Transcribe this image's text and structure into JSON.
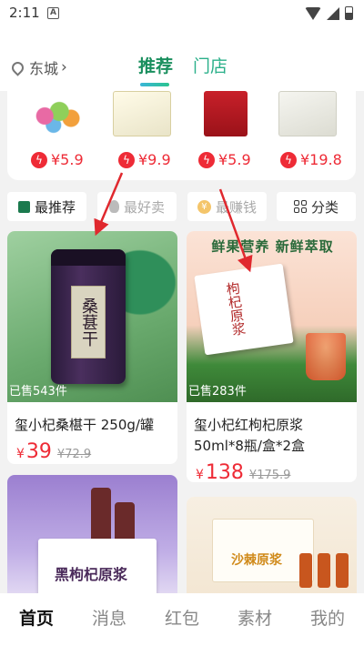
{
  "status": {
    "time": "2:11",
    "notif_badge": "A"
  },
  "header": {
    "location": "东城",
    "tabs": [
      "推荐",
      "门店"
    ],
    "active_tab": "推荐"
  },
  "flash_sale": [
    {
      "price": "¥5.9",
      "icon": "bolt-icon"
    },
    {
      "price": "¥9.9",
      "icon": "bolt-icon"
    },
    {
      "price": "¥5.9",
      "icon": "bolt-icon"
    },
    {
      "price": "¥19.8",
      "icon": "bolt-icon"
    }
  ],
  "filters": [
    {
      "label": "最推荐",
      "icon": "recommend-icon",
      "active": true
    },
    {
      "label": "最好卖",
      "icon": "hot-icon",
      "active": false
    },
    {
      "label": "最赚钱",
      "icon": "money-icon",
      "active": false
    },
    {
      "label": "分类",
      "icon": "grid-icon",
      "active": false
    }
  ],
  "products": [
    {
      "image_text": "桑葚干",
      "sold": "已售543件",
      "title": "玺小杞桑椹干 250g/罐",
      "price": "39",
      "original_price": "¥72.9",
      "currency": "¥"
    },
    {
      "image_text": "鲜果营养 新鲜萃取",
      "box_text": "枸杞原浆",
      "sold": "已售283件",
      "title": "玺小杞红枸杞原浆 50ml*8瓶/盒*2盒",
      "price": "138",
      "original_price": "¥175.9",
      "currency": "¥"
    },
    {
      "box_text": "黑枸杞原浆"
    },
    {
      "box_text": "沙棘原浆"
    }
  ],
  "bottom_nav": [
    "首页",
    "消息",
    "红包",
    "素材",
    "我的"
  ],
  "colors": {
    "accent": "#1a8f5e",
    "price": "#ee2b36",
    "annotation": "#e0282e"
  }
}
